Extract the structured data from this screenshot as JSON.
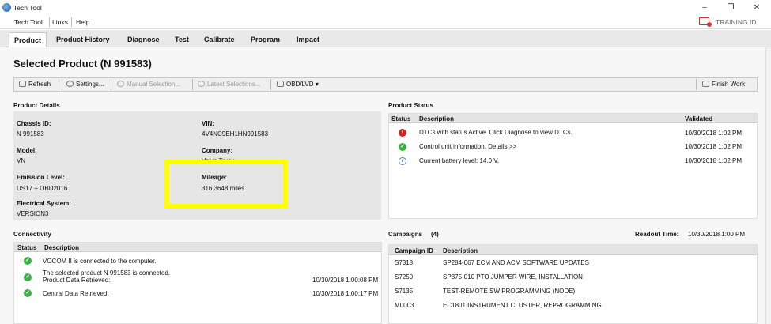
{
  "window": {
    "title": "Tech Tool",
    "controls": [
      "–",
      "❐",
      "✕"
    ]
  },
  "menu": {
    "items": [
      "Tech Tool",
      "Links",
      "Help"
    ],
    "training": "TRAINING ID"
  },
  "tabs": [
    "Product",
    "Product History",
    "Diagnose",
    "Test",
    "Calibrate",
    "Program",
    "Impact"
  ],
  "page": {
    "title": "Selected Product (N 991583)"
  },
  "toolbar": {
    "refresh": "Refresh",
    "settings": "Settings...",
    "manual": "Manual Selection...",
    "latest": "Latest Selections...",
    "obd": "OBD/LVD ▾",
    "finish": "Finish Work"
  },
  "product_details": {
    "heading": "Product Details",
    "chassis_label": "Chassis ID:",
    "chassis": "N 991583",
    "vin_label": "VIN:",
    "vin": "4V4NC9EH1HN991583",
    "model_label": "Model:",
    "model": "VN",
    "company_label": "Company:",
    "company": "Volvo Truck",
    "emission_label": "Emission Level:",
    "emission": "US17 + OBD2016",
    "mileage_label": "Mileage:",
    "mileage": "316.3648 miles",
    "electrical_label": "Electrical System:",
    "electrical": "VERSION3"
  },
  "product_status": {
    "heading": "Product Status",
    "columns": [
      "Status",
      "Description",
      "Validated"
    ],
    "rows": [
      {
        "status": "error",
        "description": "DTCs with status Active. Click Diagnose to view DTCs.",
        "validated": "10/30/2018 1:02 PM"
      },
      {
        "status": "ok",
        "description": "Control unit information. Details >>",
        "validated": "10/30/2018 1:02 PM"
      },
      {
        "status": "info",
        "description": "Current battery level: 14.0 V.",
        "validated": "10/30/2018 1:02 PM"
      }
    ]
  },
  "connectivity": {
    "heading": "Connectivity",
    "columns": [
      "Status",
      "Description"
    ],
    "rows": [
      {
        "line1": "VOCOM II is connected to the computer.",
        "line2": "",
        "time": ""
      },
      {
        "line1": "The selected product N 991583 is connected.",
        "line2": "Product Data Retrieved:",
        "time": "10/30/2018 1:00:08 PM"
      },
      {
        "line1": "Central Data Retrieved:",
        "line2": "",
        "time": "10/30/2018 1:00:17 PM"
      }
    ]
  },
  "campaigns": {
    "heading": "Campaigns",
    "count": "(4)",
    "readout_label": "Readout Time:",
    "readout": "10/30/2018 1:00 PM",
    "columns": [
      "Campaign ID",
      "Description"
    ],
    "rows": [
      {
        "id": "S7318",
        "description": "SP284-067 ECM AND ACM SOFTWARE UPDATES"
      },
      {
        "id": "S7250",
        "description": "SP375-010 PTO JUMPER WIRE, INSTALLATION"
      },
      {
        "id": "S7135",
        "description": "TEST-REMOTE SW PROGRAMMING (NODE)"
      },
      {
        "id": "M0003",
        "description": "EC1801 INSTRUMENT CLUSTER, REPROGRAMMING"
      }
    ]
  },
  "colors": {
    "highlight": "#ffff00",
    "ok": "#3cb043",
    "error": "#d62020"
  }
}
